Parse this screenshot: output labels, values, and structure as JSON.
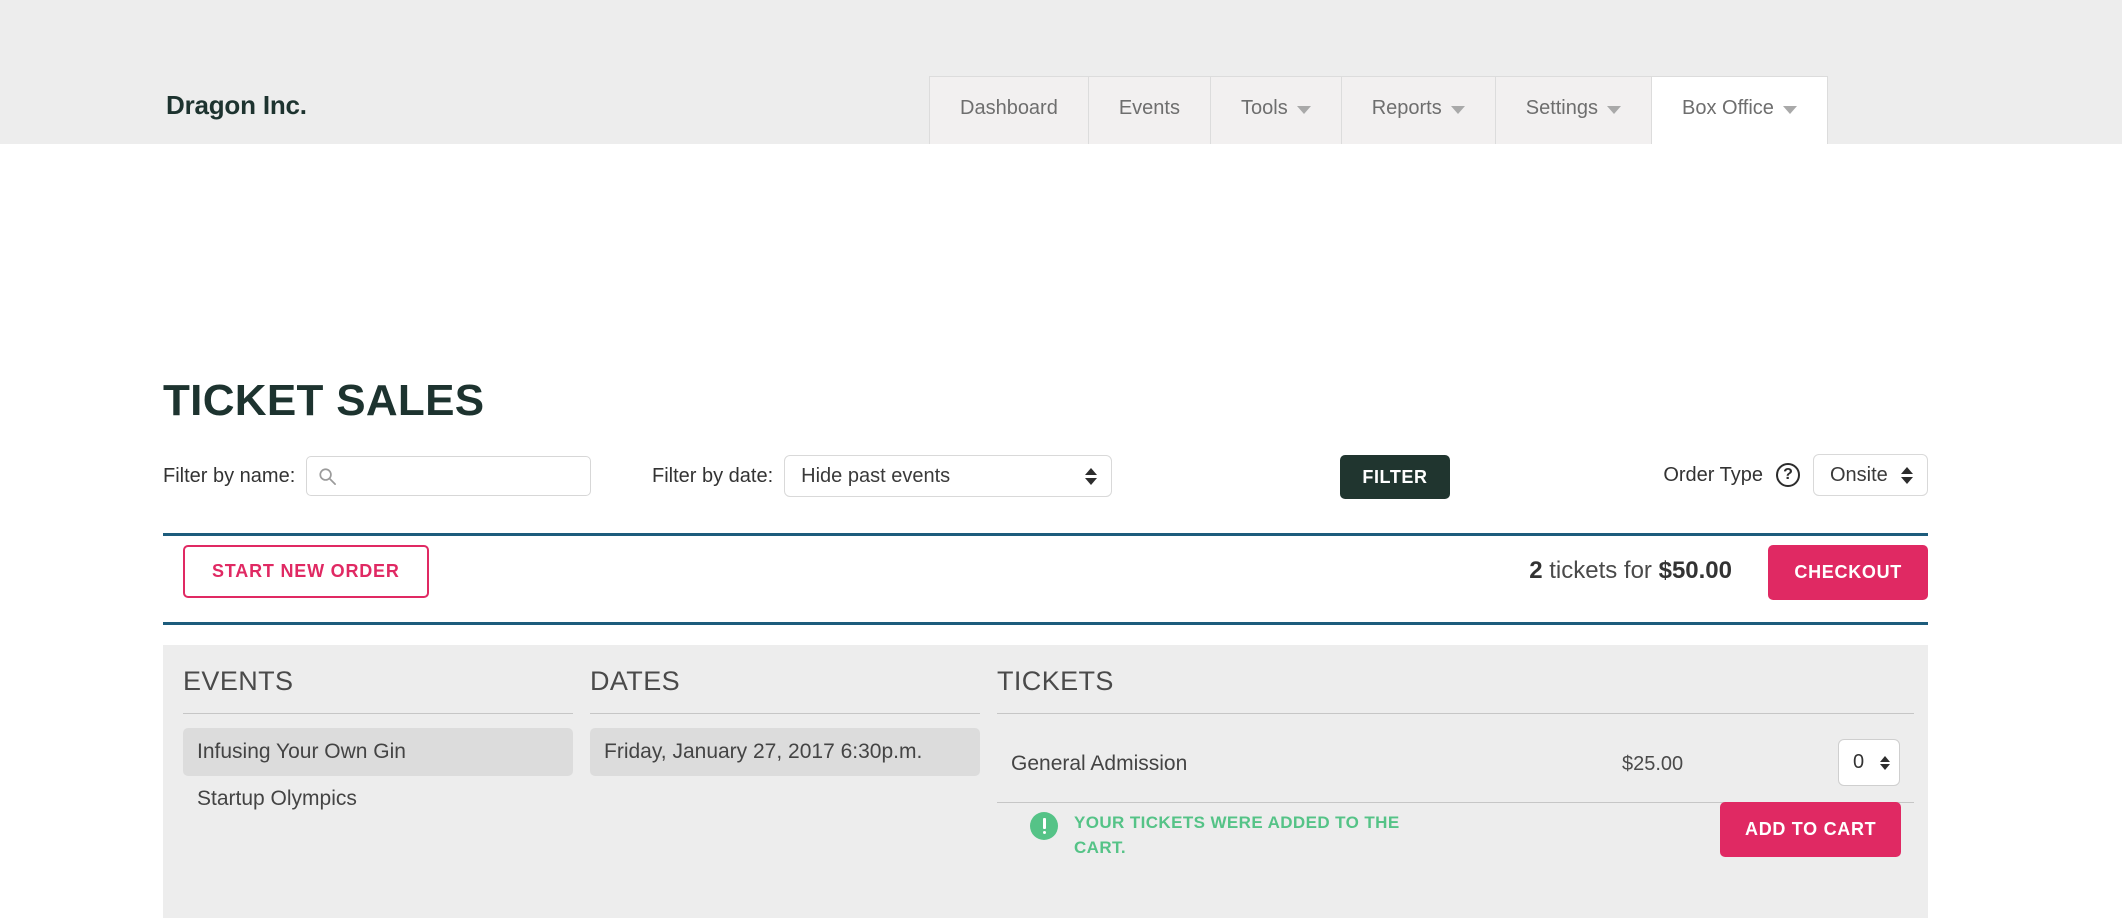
{
  "header": {
    "brand": "Dragon Inc.",
    "nav": [
      {
        "label": "Dashboard",
        "has_caret": false,
        "active": false
      },
      {
        "label": "Events",
        "has_caret": false,
        "active": false
      },
      {
        "label": "Tools",
        "has_caret": true,
        "active": false
      },
      {
        "label": "Reports",
        "has_caret": true,
        "active": false
      },
      {
        "label": "Settings",
        "has_caret": true,
        "active": false
      },
      {
        "label": "Box Office",
        "has_caret": true,
        "active": true
      }
    ]
  },
  "page": {
    "title": "TICKET SALES"
  },
  "filters": {
    "name_label": "Filter by name:",
    "name_value": "",
    "name_placeholder": "",
    "search_icon": "search-icon",
    "date_label": "Filter by date:",
    "date_value": "Hide past events",
    "filter_button": "FILTER",
    "order_type_label": "Order Type",
    "help_icon": "question-mark-icon",
    "order_type_value": "Onsite"
  },
  "order_bar": {
    "start_new_order": "START NEW ORDER",
    "cart_count": "2",
    "cart_middle": " tickets for ",
    "cart_total": "$50.00",
    "checkout": "CHECKOUT"
  },
  "panel": {
    "columns": {
      "events": "EVENTS",
      "dates": "DATES",
      "tickets": "TICKETS"
    },
    "events": [
      {
        "label": "Infusing Your Own Gin",
        "selected": true
      },
      {
        "label": "Startup Olympics",
        "selected": false
      }
    ],
    "dates": [
      {
        "label": "Friday, January 27, 2017 6:30p.m.",
        "selected": true
      }
    ],
    "tickets": [
      {
        "name": "General Admission",
        "price": "$25.00",
        "quantity": "0"
      }
    ],
    "alert": {
      "icon": "exclamation-circle-icon",
      "text": "YOUR TICKETS WERE ADDED TO THE CART.",
      "color": "#55c387"
    },
    "add_to_cart": "ADD TO CART"
  },
  "colors": {
    "brand_dark": "#1d332f",
    "accent_pink": "#e02963",
    "rule_teal": "#1d5c7c",
    "panel_gray": "#ededed",
    "success_green": "#55c387"
  }
}
